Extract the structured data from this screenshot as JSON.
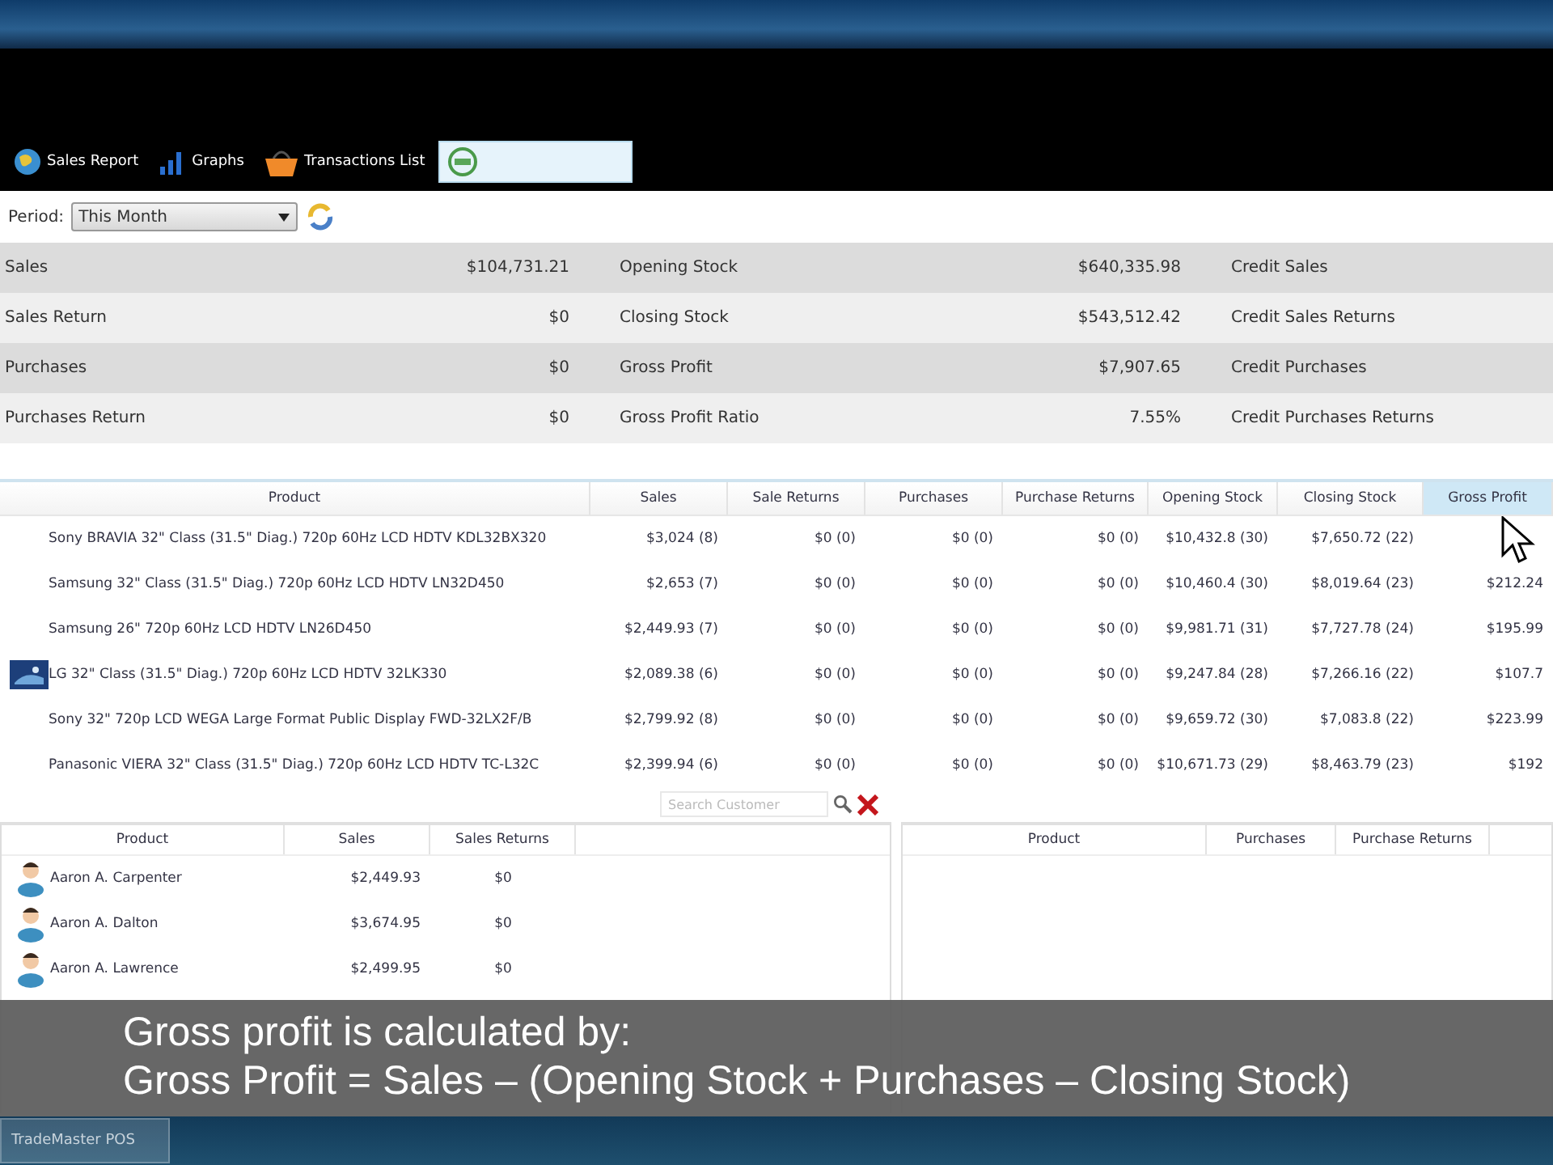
{
  "tabs": [
    {
      "label": "Sales Report",
      "kind": "globe",
      "selected": false
    },
    {
      "label": "Graphs",
      "kind": "bars",
      "selected": false
    },
    {
      "label": "Transactions List",
      "kind": "basket",
      "selected": false
    },
    {
      "kind": "badge",
      "selected": true
    }
  ],
  "period": {
    "label": "Period:",
    "value": "This Month"
  },
  "summary": {
    "rows": [
      {
        "cells": [
          "Sales",
          "$104,731.21",
          "Opening Stock",
          "$640,335.98",
          "Credit Sales"
        ]
      },
      {
        "cells": [
          "Sales Return",
          "$0",
          "Closing Stock",
          "$543,512.42",
          "Credit Sales Returns"
        ]
      },
      {
        "cells": [
          "Purchases",
          "$0",
          "Gross Profit",
          "$7,907.65",
          "Credit Purchases"
        ]
      },
      {
        "cells": [
          "Purchases Return",
          "$0",
          "Gross Profit Ratio",
          "7.55%",
          "Credit Purchases Returns"
        ]
      }
    ]
  },
  "products": {
    "columns": [
      {
        "label": "Product",
        "selected": false
      },
      {
        "label": "Sales",
        "selected": false
      },
      {
        "label": "Sale Returns",
        "selected": false
      },
      {
        "label": "Purchases",
        "selected": false
      },
      {
        "label": "Purchase Returns",
        "selected": false
      },
      {
        "label": "Opening Stock",
        "selected": false
      },
      {
        "label": "Closing Stock",
        "selected": false
      },
      {
        "label": "Gross Profit",
        "selected": true
      }
    ],
    "rows": [
      {
        "thumbnail": false,
        "cells": [
          "Sony BRAVIA 32\" Class (31.5\" Diag.) 720p 60Hz LCD HDTV KDL32BX320",
          "$3,024 (8)",
          "$0 (0)",
          "$0 (0)",
          "$0 (0)",
          "$10,432.8 (30)",
          "$7,650.72 (22)"
        ]
      },
      {
        "thumbnail": false,
        "cells": [
          "Samsung 32\" Class (31.5\" Diag.) 720p 60Hz LCD HDTV LN32D450",
          "$2,653 (7)",
          "$0 (0)",
          "$0 (0)",
          "$0 (0)",
          "$10,460.4 (30)",
          "$8,019.64 (23)",
          "$212.24"
        ]
      },
      {
        "thumbnail": false,
        "cells": [
          "Samsung 26\" 720p 60Hz LCD HDTV LN26D450",
          "$2,449.93 (7)",
          "$0 (0)",
          "$0 (0)",
          "$0 (0)",
          "$9,981.71 (31)",
          "$7,727.78 (24)",
          "$195.99"
        ]
      },
      {
        "thumbnail": true,
        "cells": [
          "LG 32\" Class (31.5\" Diag.) 720p 60Hz LCD HDTV 32LK330",
          "$2,089.38 (6)",
          "$0 (0)",
          "$0 (0)",
          "$0 (0)",
          "$9,247.84 (28)",
          "$7,266.16 (22)",
          "$107.7"
        ]
      },
      {
        "thumbnail": false,
        "cells": [
          "Sony 32\" 720p LCD WEGA Large Format Public Display FWD-32LX2F/B",
          "$2,799.92 (8)",
          "$0 (0)",
          "$0 (0)",
          "$0 (0)",
          "$9,659.72 (30)",
          "$7,083.8 (22)",
          "$223.99"
        ]
      },
      {
        "thumbnail": false,
        "cells": [
          "Panasonic VIERA 32\" Class (31.5\" Diag.) 720p 60Hz LCD HDTV TC-L32C",
          "$2,399.94 (6)",
          "$0 (0)",
          "$0 (0)",
          "$0 (0)",
          "$10,671.73 (29)",
          "$8,463.79 (23)",
          "$192"
        ]
      }
    ]
  },
  "search": {
    "placeholder": "Search Customer"
  },
  "customers": {
    "columns": [
      "Product",
      "Sales",
      "Sales Returns"
    ],
    "rows": [
      {
        "cells": [
          "Aaron A. Carpenter",
          "$2,449.93",
          "$0"
        ]
      },
      {
        "cells": [
          "Aaron A. Dalton",
          "$3,674.95",
          "$0"
        ]
      },
      {
        "cells": [
          "Aaron A. Lawrence",
          "$2,499.95",
          "$0"
        ]
      }
    ]
  },
  "purchases": {
    "columns": [
      "Product",
      "Purchases",
      "Purchase Returns"
    ]
  },
  "caption": {
    "lines": [
      "Gross profit is calculated by:",
      "Gross Profit = Sales – (Opening Stock + Purchases – Closing Stock)"
    ]
  },
  "taskbar": {
    "items": [
      {
        "label": "TradeMaster POS"
      }
    ]
  }
}
